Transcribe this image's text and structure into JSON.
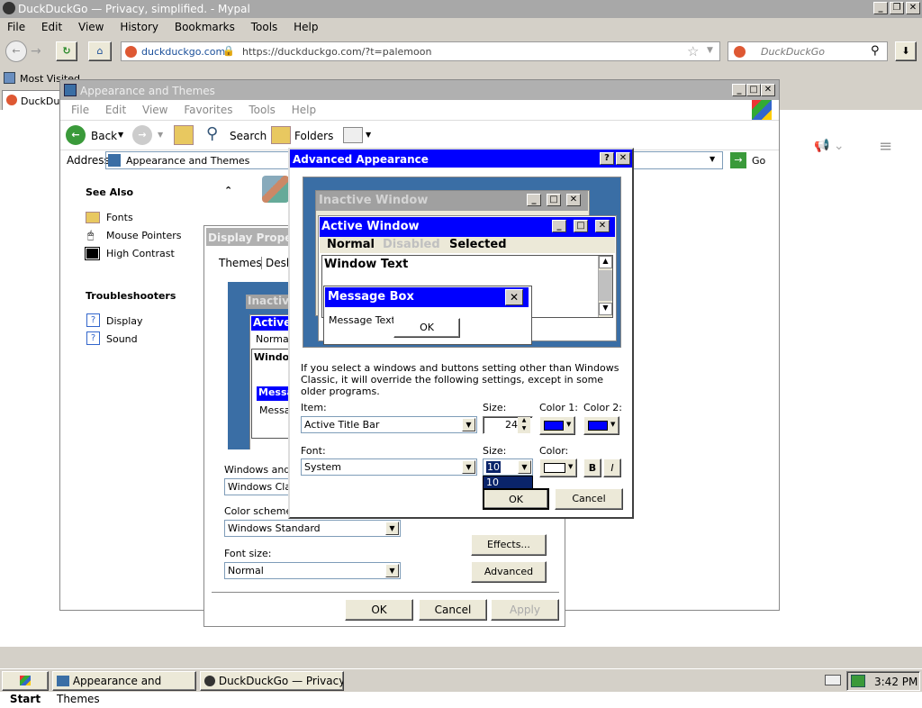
{
  "browser": {
    "title": "DuckDuckGo — Privacy, simplified. - Mypal",
    "menu": [
      "File",
      "Edit",
      "View",
      "History",
      "Bookmarks",
      "Tools",
      "Help"
    ],
    "site_badge": "duckduckgo.com",
    "url": "https://duckduckgo.com/?t=palemoon",
    "search_placeholder": "DuckDuckGo",
    "bookmark": "Most Visited",
    "tab": "DuckDuck"
  },
  "control_panel": {
    "title": "Appearance and Themes",
    "menu": [
      "File",
      "Edit",
      "View",
      "Favorites",
      "Tools",
      "Help"
    ],
    "back": "Back",
    "search": "Search",
    "folders": "Folders",
    "address_label": "Address",
    "address_value": "Appearance and Themes",
    "go": "Go",
    "see_also": "See Also",
    "see_also_items": [
      "Fonts",
      "Mouse Pointers",
      "High Contrast"
    ],
    "troubleshooters": "Troubleshooters",
    "trouble_items": [
      "Display",
      "Sound"
    ]
  },
  "display_props": {
    "title": "Display Properti",
    "tabs": [
      "Themes",
      "Deskt"
    ],
    "preview": {
      "inactive": "Inactive",
      "active": "Active",
      "normal": "Normal",
      "window": "Windo",
      "msg": "Messa",
      "msgtext": "Messag"
    },
    "windows_buttons_label": "Windows and b",
    "windows_buttons_value": "Windows Clas",
    "color_scheme_label": "Color scheme:",
    "color_scheme_value": "Windows Standard",
    "font_size_label": "Font size:",
    "font_size_value": "Normal",
    "effects": "Effects...",
    "advanced": "Advanced",
    "ok": "OK",
    "cancel": "Cancel",
    "apply": "Apply"
  },
  "advanced": {
    "title": "Advanced Appearance",
    "inactive_window": "Inactive Window",
    "active_window": "Active Window",
    "menu_normal": "Normal",
    "menu_disabled": "Disabled",
    "menu_selected": "Selected",
    "window_text": "Window Text",
    "message_box": "Message Box",
    "message_text": "Message Text",
    "msg_ok": "OK",
    "info": "If you select a windows and buttons setting other than Windows Classic, it will override the following settings, except in some older programs.",
    "item_label": "Item:",
    "item_value": "Active Title Bar",
    "size_label": "Size:",
    "size_value": "24",
    "color1_label": "Color 1:",
    "color2_label": "Color 2:",
    "font_label": "Font:",
    "font_value": "System",
    "font_size_label": "Size:",
    "font_size_value": "10",
    "font_size_dropdown": "10",
    "color_label": "Color:",
    "bold": "B",
    "italic": "I",
    "ok": "OK",
    "cancel": "Cancel"
  },
  "taskbar": {
    "start": "Start",
    "tasks": [
      "Appearance and Themes",
      "DuckDuckGo — Privacy, ..."
    ],
    "clock": "3:42 PM"
  },
  "colors": {
    "active_title": "#0000ff",
    "inactive_title": "#a0a0a0",
    "desktop_preview": "#3a6ea5",
    "browser_chrome": "#d4d0c8"
  }
}
